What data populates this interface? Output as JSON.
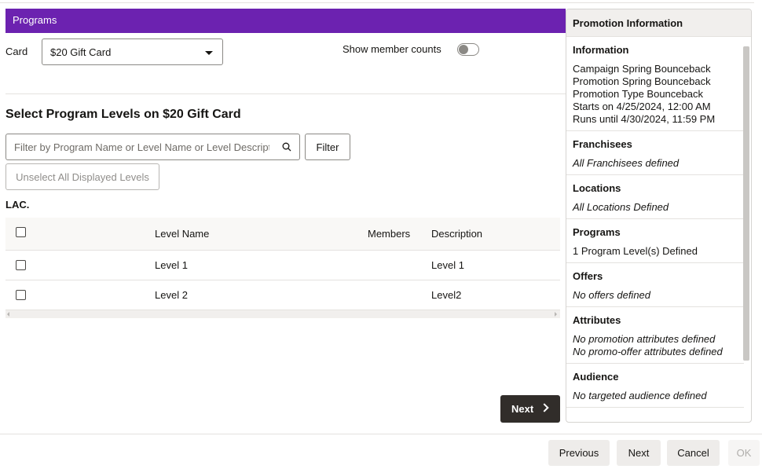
{
  "programs_panel": {
    "header": "Programs",
    "card_label": "Card",
    "card_value": "$20 Gift Card",
    "show_member_counts_label": "Show member counts",
    "section_title": "Select Program Levels on $20 Gift Card",
    "filter_placeholder": "Filter by Program Name or Level Name or Level Description",
    "filter_button": "Filter",
    "unselect_button": "Unselect All Displayed Levels",
    "group_label": "LAC.",
    "table": {
      "headers": [
        "Level Name",
        "Members",
        "Description"
      ],
      "rows": [
        {
          "level_name": "Level 1",
          "members": "",
          "description": "Level 1"
        },
        {
          "level_name": "Level 2",
          "members": "",
          "description": "Level2"
        }
      ]
    },
    "next_button": "Next"
  },
  "promotion_info": {
    "header": "Promotion Information",
    "information": {
      "title": "Information",
      "lines": [
        "Campaign Spring Bounceback",
        "Promotion Spring Bounceback",
        "Promotion Type Bounceback",
        "Starts on 4/25/2024, 12:00 AM",
        "Runs until 4/30/2024, 11:59 PM"
      ]
    },
    "franchisees": {
      "title": "Franchisees",
      "value": "All Franchisees defined"
    },
    "locations": {
      "title": "Locations",
      "value": "All Locations Defined"
    },
    "programs": {
      "title": "Programs",
      "value": "1 Program Level(s) Defined"
    },
    "offers": {
      "title": "Offers",
      "value": "No offers defined"
    },
    "attributes": {
      "title": "Attributes",
      "lines": [
        "No promotion attributes defined",
        "No promo-offer attributes defined"
      ]
    },
    "audience": {
      "title": "Audience",
      "value": "No targeted audience defined"
    }
  },
  "footer": {
    "previous": "Previous",
    "next": "Next",
    "cancel": "Cancel",
    "ok": "OK"
  },
  "colors": {
    "header_purple": "#6c22b0",
    "dark_button": "#312d2a"
  }
}
